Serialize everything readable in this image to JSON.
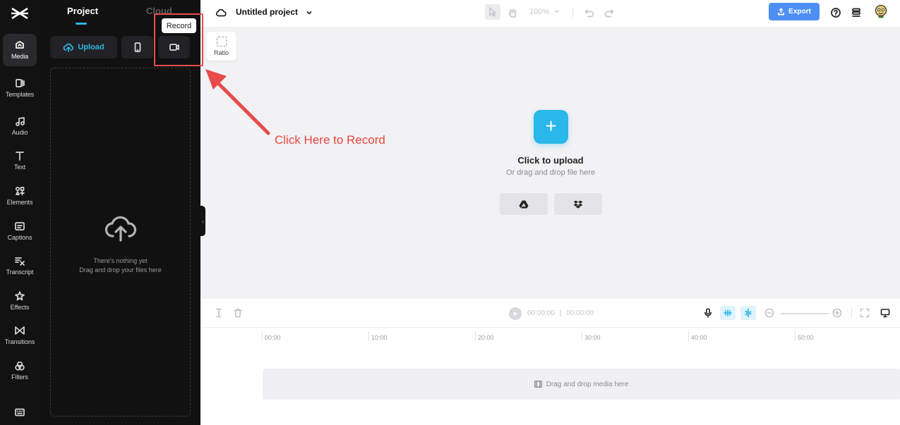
{
  "rail": {
    "items": [
      {
        "label": "Media",
        "icon": "media-icon",
        "active": true
      },
      {
        "label": "Templates",
        "icon": "templates-icon"
      },
      {
        "label": "Audio",
        "icon": "audio-icon"
      },
      {
        "label": "Text",
        "icon": "text-icon"
      },
      {
        "label": "Elements",
        "icon": "elements-icon"
      },
      {
        "label": "Captions",
        "icon": "captions-icon"
      },
      {
        "label": "Transcript",
        "icon": "transcript-icon"
      },
      {
        "label": "Effects",
        "icon": "effects-icon"
      },
      {
        "label": "Transitions",
        "icon": "transitions-icon"
      },
      {
        "label": "Filters",
        "icon": "filters-icon"
      }
    ]
  },
  "panel": {
    "tabs": [
      {
        "label": "Project",
        "active": true
      },
      {
        "label": "Cloud",
        "active": false
      }
    ],
    "upload_label": "Upload",
    "empty_line1": "There's nothing yet",
    "empty_line2": "Drag and drop your files here"
  },
  "tooltip": {
    "text": "Record"
  },
  "annotation": {
    "text": "Click Here to Record",
    "color": "#e8453c"
  },
  "header": {
    "title": "Untitled project",
    "zoom": "100%",
    "export_label": "Export"
  },
  "ratio": {
    "label": "Ratio"
  },
  "canvas": {
    "upload_title": "Click to upload",
    "upload_subtitle": "Or drag and drop file here",
    "sources": [
      "google-drive-icon",
      "dropbox-icon"
    ]
  },
  "timeline": {
    "time_current": "00:00:00",
    "time_separator": "|",
    "time_total": "00:00:00",
    "ticks": [
      "00:00",
      "10:00",
      "20:00",
      "30:00",
      "40:00",
      "50:00"
    ],
    "track_hint": "Drag and drop media here"
  },
  "colors": {
    "accent": "#2ab7ea",
    "export": "#4d8ff5",
    "annotation": "#e94b4b",
    "sidebar_bg": "#121212"
  }
}
